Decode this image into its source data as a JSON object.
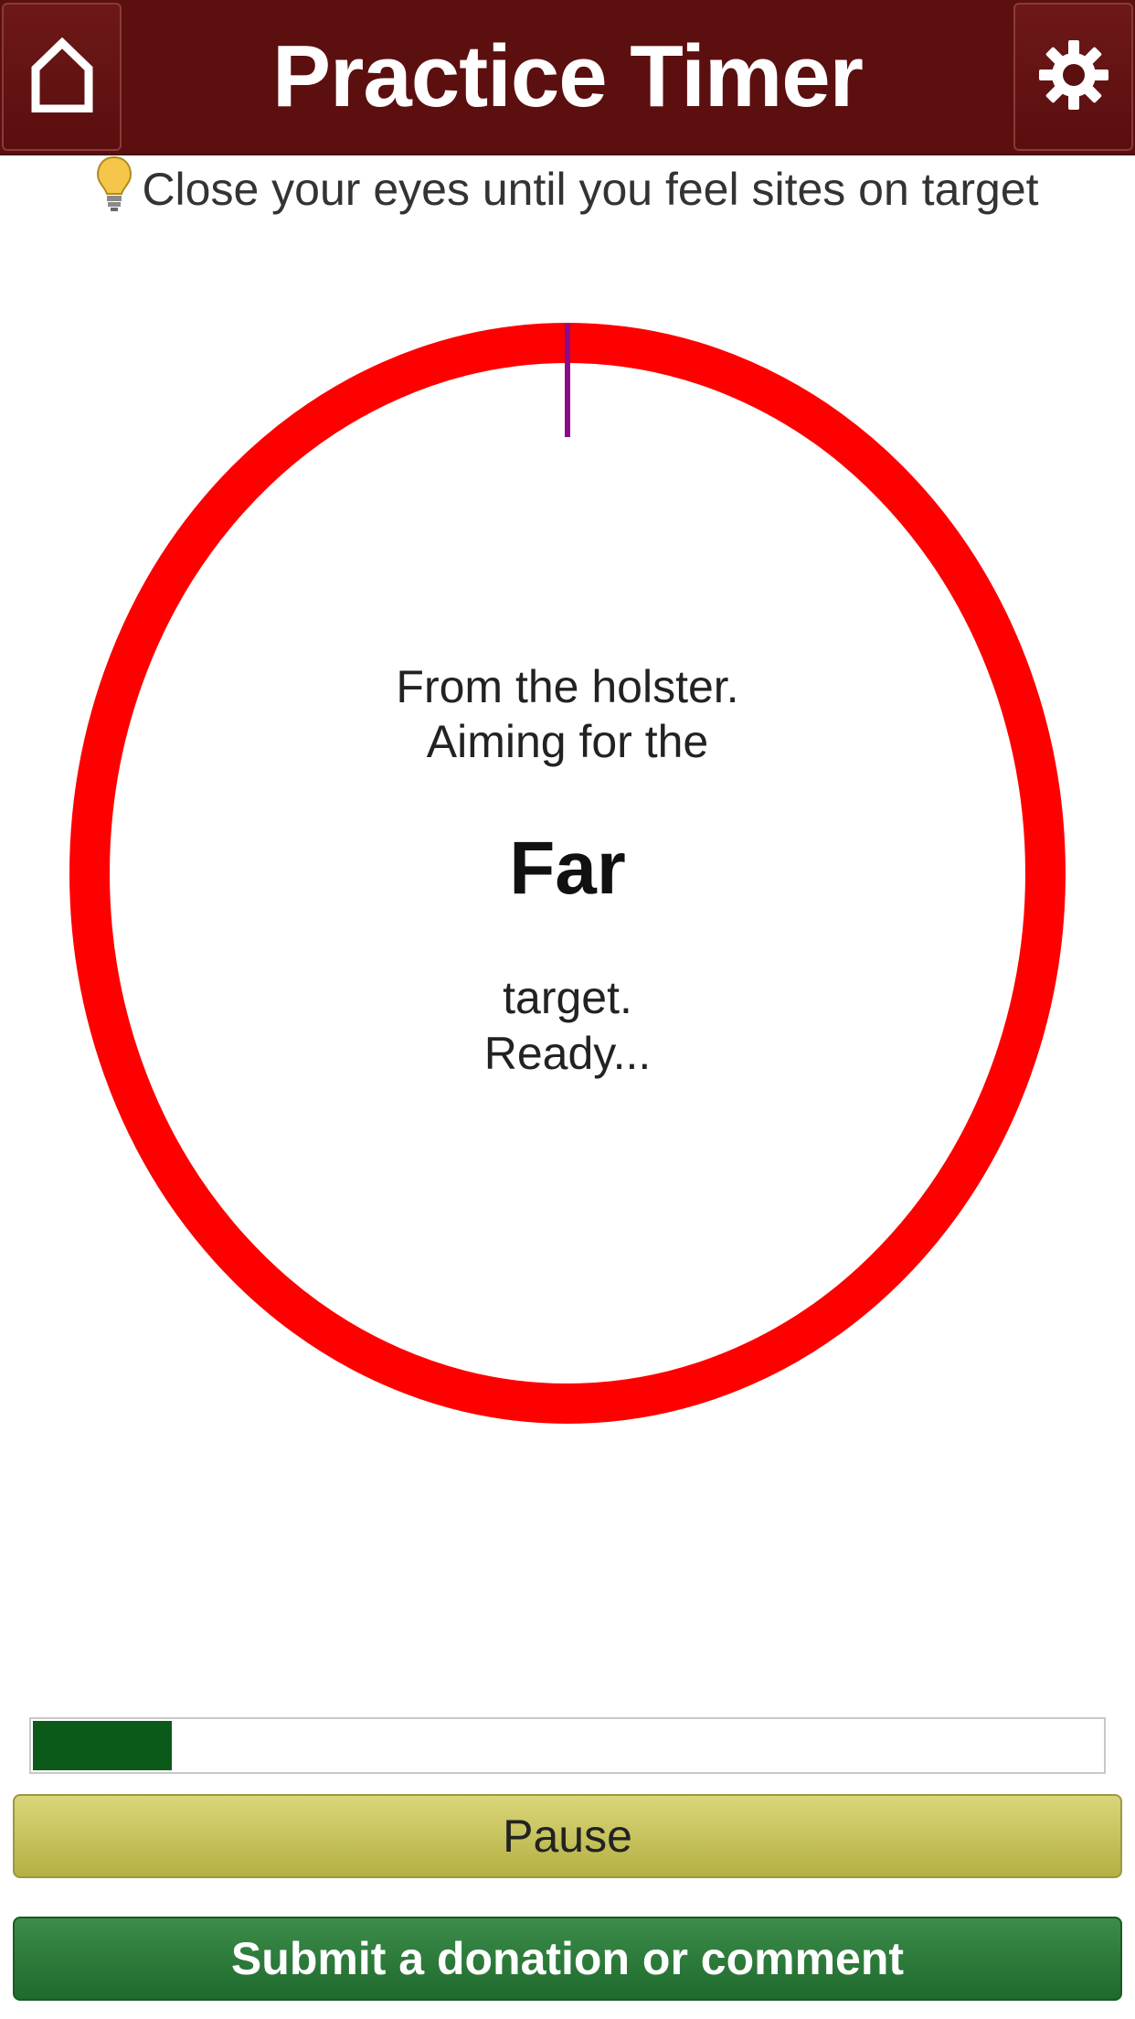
{
  "header": {
    "title": "Practice Timer",
    "home_icon": "home-icon",
    "settings_icon": "gear-icon"
  },
  "tip": {
    "icon": "lightbulb-icon",
    "text": "Close your eyes until you feel sites on target"
  },
  "timer": {
    "line1": "From the holster.",
    "line2": "Aiming for the",
    "target": "Far",
    "line3": "target.",
    "line4": "Ready...",
    "ring_color": "#ff0000",
    "hand_color": "#8b0a8b"
  },
  "progress": {
    "fraction": 0.13,
    "fill_color": "#0b5a1a"
  },
  "buttons": {
    "pause_label": "Pause",
    "donate_label": "Submit a donation or comment"
  }
}
